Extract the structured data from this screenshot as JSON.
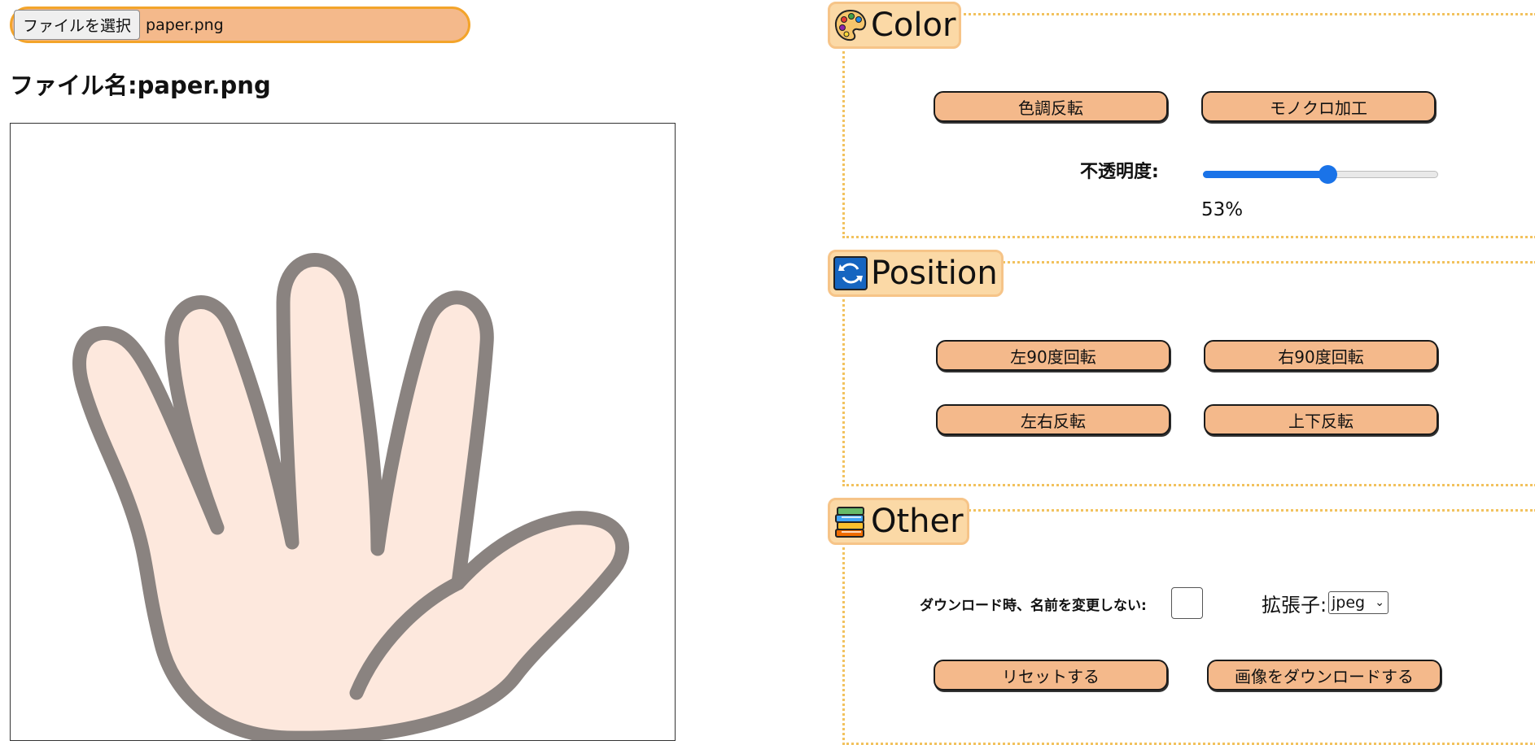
{
  "file_picker": {
    "button_label": "ファイルを選択",
    "selected_file": "paper.png"
  },
  "heading": {
    "prefix": "ファイル名:",
    "file_name": "paper.png"
  },
  "preview": {
    "image_icon": "open-hand-icon"
  },
  "sections": {
    "color": {
      "title": "Color",
      "icon": "palette-icon",
      "invert_button": "色調反転",
      "mono_button": "モノクロ加工",
      "opacity_label": "不透明度:",
      "opacity_value": 53,
      "opacity_text": "53%"
    },
    "position": {
      "title": "Position",
      "icon": "rotate-arrows-icon",
      "rotate_left": "左90度回転",
      "rotate_right": "右90度回転",
      "flip_horizontal": "左右反転",
      "flip_vertical": "上下反転"
    },
    "other": {
      "title": "Other",
      "icon": "books-icon",
      "keep_name_label": "ダウンロード時、名前を変更しない:",
      "keep_name_checked": false,
      "extension_label": "拡張子:",
      "extension_value": "jpeg",
      "reset_button": "リセットする",
      "download_button": "画像をダウンロードする"
    }
  },
  "colors": {
    "accent_orange": "#f4b98b",
    "picker_border": "#f3a42a",
    "dotted_border": "#f2c25e",
    "slider_blue": "#1a73e8"
  }
}
